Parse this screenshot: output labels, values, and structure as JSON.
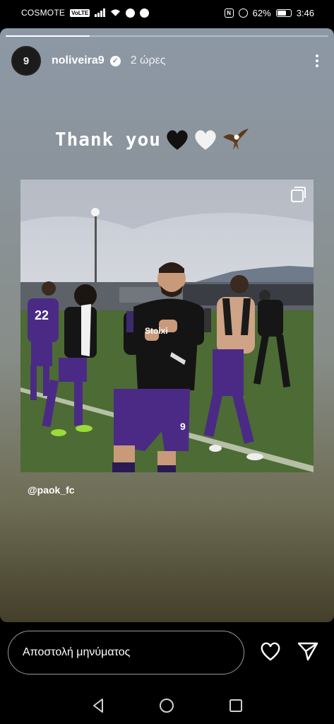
{
  "status_bar": {
    "carrier": "COSMOTE",
    "volte": "VoLTE",
    "battery": "62%",
    "time": "3:46"
  },
  "story": {
    "progress": 0.26,
    "username": "noliveira9",
    "time_ago": "2 ώρες",
    "avatar_text": "9",
    "caption": "Thank you",
    "mention": "@paok_fc",
    "photo": {
      "player_number": "9",
      "shirt_text": "Stoiximan",
      "left_player_number": "22"
    }
  },
  "reply": {
    "placeholder": "Αποστολή μηνύματος"
  },
  "colors": {
    "purple": "#4b2a86",
    "pitch": "#4d6b34",
    "sky": "#c9ced6"
  }
}
